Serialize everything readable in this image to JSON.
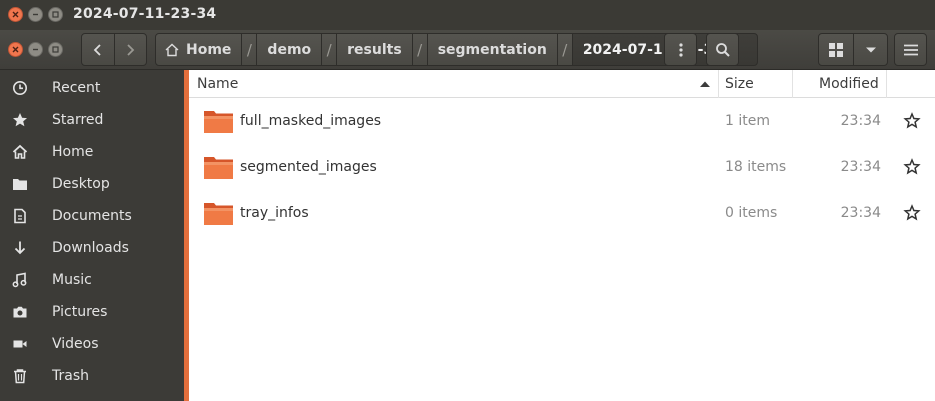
{
  "window": {
    "title": "2024-07-11-23-34"
  },
  "path": {
    "crumbs": [
      "Home",
      "demo",
      "results",
      "segmentation"
    ],
    "current": "2024-07-11-23-34",
    "home_icon": "home-icon"
  },
  "columns": {
    "name": "Name",
    "size": "Size",
    "modified": "Modified"
  },
  "sidebar": {
    "items": [
      {
        "label": "Recent",
        "icon": "clock-icon"
      },
      {
        "label": "Starred",
        "icon": "star-icon"
      },
      {
        "label": "Home",
        "icon": "home-icon"
      },
      {
        "label": "Desktop",
        "icon": "folder-icon"
      },
      {
        "label": "Documents",
        "icon": "document-icon"
      },
      {
        "label": "Downloads",
        "icon": "download-icon"
      },
      {
        "label": "Music",
        "icon": "music-icon"
      },
      {
        "label": "Pictures",
        "icon": "camera-icon"
      },
      {
        "label": "Videos",
        "icon": "video-icon"
      },
      {
        "label": "Trash",
        "icon": "trash-icon"
      }
    ]
  },
  "files": [
    {
      "name": "full_masked_images",
      "size": "1 item",
      "modified": "23:34"
    },
    {
      "name": "segmented_images",
      "size": "18 items",
      "modified": "23:34"
    },
    {
      "name": "tray_infos",
      "size": "0 items",
      "modified": "23:34"
    }
  ],
  "colors": {
    "accent": "#e36f3c",
    "sidebar_bg": "#3c3b37",
    "close": "#f0764e"
  }
}
